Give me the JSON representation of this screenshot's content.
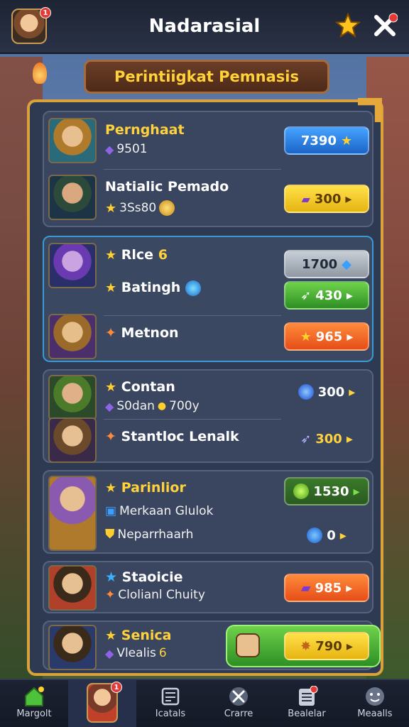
{
  "header": {
    "title": "Nadarasial",
    "notification_count": "1"
  },
  "banner": {
    "title": "Perintiigkat Pemnasis"
  },
  "groups": [
    {
      "rows": [
        {
          "name": "Pernghaat",
          "sub_text": "9501",
          "price": "7390"
        },
        {
          "name": "Natialic Pemado",
          "sub_text": "3Ss80",
          "price": "300"
        }
      ]
    },
    {
      "rows": [
        {
          "name": "Rlce",
          "sub_num": "6",
          "price": "1700"
        },
        {
          "name": "Batingh",
          "price": "430"
        },
        {
          "name": "Metnon",
          "price": "965"
        }
      ]
    },
    {
      "rows": [
        {
          "name": "Contan",
          "sub_a": "S0dan",
          "sub_b": "700y",
          "price": "300"
        },
        {
          "name": "Stantloc Lenalk",
          "price": "300"
        }
      ]
    },
    {
      "rows": [
        {
          "name": "Parinlior",
          "price": "1530"
        },
        {
          "name": "Merkaan Glulok"
        },
        {
          "name": "Neparrhaarh",
          "price": "0"
        }
      ]
    },
    {
      "rows": [
        {
          "name": "Staoicie",
          "sub_text": "Clolianl Chuity",
          "price": "985"
        }
      ]
    },
    {
      "rows": [
        {
          "name": "Senica",
          "sub_text": "Vlealis",
          "sub_num": "6",
          "price": "790"
        }
      ]
    }
  ],
  "nav": [
    {
      "label": "Margolt",
      "icon": "home-icon"
    },
    {
      "label": "",
      "icon": "profile-avatar",
      "badge": "1"
    },
    {
      "label": "Icatals",
      "icon": "cards-icon"
    },
    {
      "label": "Crarre",
      "icon": "swords-icon"
    },
    {
      "label": "Bealelar",
      "icon": "list-icon",
      "badge": ""
    },
    {
      "label": "Meaalls",
      "icon": "smiley-icon"
    }
  ],
  "colors": {
    "accent": "#ffd23c",
    "panel_border": "#d9a23a",
    "top_bar": "#1d2433"
  }
}
